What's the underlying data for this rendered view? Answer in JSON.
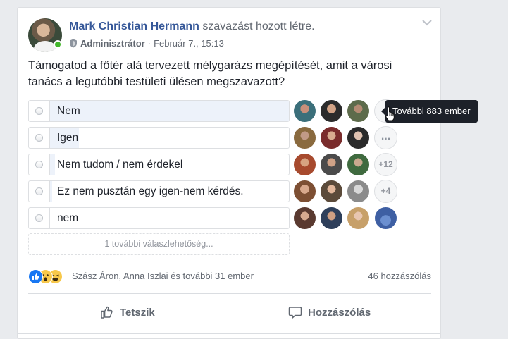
{
  "post": {
    "author": "Mark Christian Hermann",
    "action": " szavazást hozott létre.",
    "role": "Adminisztrátor",
    "separator": " · ",
    "date": "Február 7., 15:13",
    "question": "Támogatod a főtér alá tervezett mélygarázs megépítését, amit a városi tanács a legutóbbi testületi ülésen megszavazott?"
  },
  "poll": {
    "options": [
      {
        "label": "Nem",
        "fill_fraction": 1.0,
        "more_badge": ""
      },
      {
        "label": "Igen",
        "fill_fraction": 0.12,
        "more_badge": "..."
      },
      {
        "label": "Nem tudom / nem érdekel",
        "fill_fraction": 0.02,
        "more_badge": "+12"
      },
      {
        "label": "Ez nem pusztán egy igen-nem kérdés.",
        "fill_fraction": 0.01,
        "more_badge": "+4"
      },
      {
        "label": "nem",
        "fill_fraction": 0.0,
        "more_badge": ""
      }
    ],
    "more_options": "1 további válaszlehetőség...",
    "tooltip": "További 883 ember"
  },
  "reactions": {
    "names": "Szász Áron, Anna Iszlai és további 31 ember",
    "comments": "46 hozzászólás",
    "icons": [
      "like-icon",
      "wow-icon",
      "haha-icon"
    ]
  },
  "actions": {
    "like": "Tetszik",
    "comment": "Hozzászólás"
  },
  "colors": {
    "link": "#365899",
    "poll_fill": "#edf2fa",
    "online": "#42b72a",
    "like_blue": "#1877f2",
    "emoji_yellow": "#f7c84b"
  }
}
